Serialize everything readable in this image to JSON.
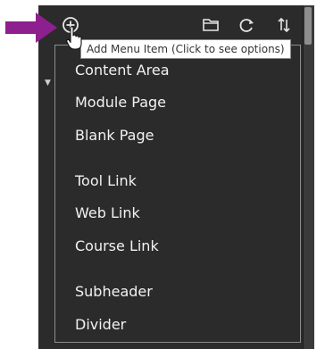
{
  "tooltip": "Add Menu Item (Click to see options)",
  "menu": {
    "items": [
      {
        "label": "Content Area"
      },
      {
        "label": "Module Page"
      },
      {
        "label": "Blank Page"
      },
      {
        "label": "Tool Link"
      },
      {
        "label": "Web Link"
      },
      {
        "label": "Course Link"
      },
      {
        "label": "Subheader"
      },
      {
        "label": "Divider"
      }
    ]
  },
  "toolbar": {
    "icons": [
      "add-menu-item-icon",
      "folder-icon",
      "refresh-icon",
      "sort-icon"
    ]
  },
  "colors": {
    "panel": "#2b2b2b",
    "arrow": "#8e1f8e",
    "menu_text": "#f2f2f2"
  }
}
